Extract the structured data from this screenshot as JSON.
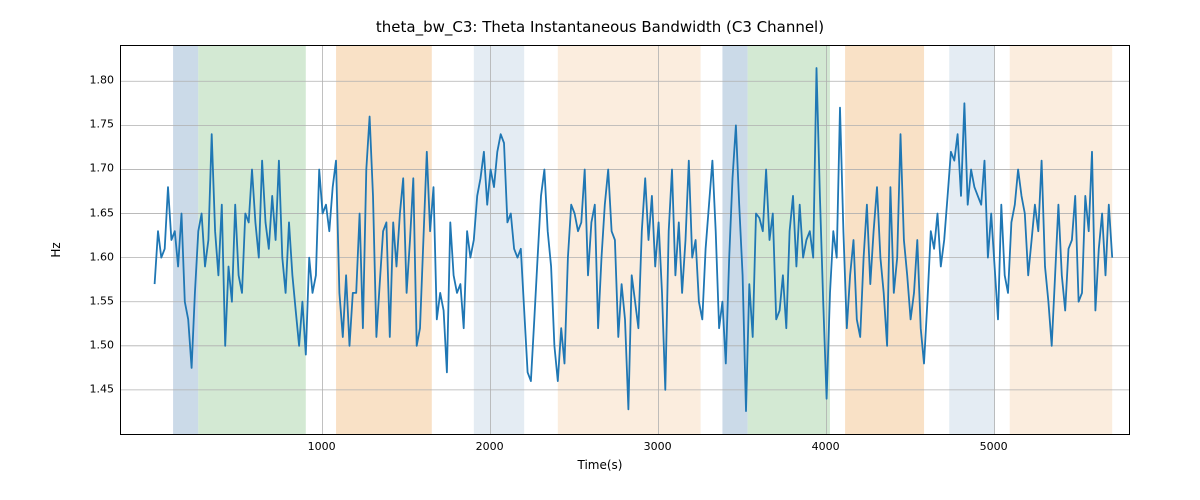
{
  "chart_data": {
    "type": "line",
    "title": "theta_bw_C3: Theta Instantaneous Bandwidth (C3 Channel)",
    "xlabel": "Time(s)",
    "ylabel": "Hz",
    "xlim": [
      -200,
      5800
    ],
    "ylim": [
      1.4,
      1.84
    ],
    "xticks": [
      1000,
      2000,
      3000,
      4000,
      5000
    ],
    "yticks": [
      1.45,
      1.5,
      1.55,
      1.6,
      1.65,
      1.7,
      1.75,
      1.8
    ],
    "grid": true,
    "line_color": "#1f77b4",
    "regions": [
      {
        "x0": 110,
        "x1": 260,
        "color": "#b9cee0"
      },
      {
        "x0": 260,
        "x1": 900,
        "color": "#c4e1c4"
      },
      {
        "x0": 1080,
        "x1": 1650,
        "color": "#f7d7b3"
      },
      {
        "x0": 1900,
        "x1": 2200,
        "color": "#dbe5ef"
      },
      {
        "x0": 2400,
        "x1": 3250,
        "color": "#f9e7d3"
      },
      {
        "x0": 3380,
        "x1": 3530,
        "color": "#b9cee0"
      },
      {
        "x0": 3530,
        "x1": 4020,
        "color": "#c4e1c4"
      },
      {
        "x0": 4110,
        "x1": 4580,
        "color": "#f7d7b3"
      },
      {
        "x0": 4730,
        "x1": 5000,
        "color": "#dbe5ef"
      },
      {
        "x0": 5090,
        "x1": 5700,
        "color": "#f9e7d3"
      }
    ],
    "series": [
      {
        "name": "theta_bw_C3",
        "x": [
          0,
          20,
          40,
          60,
          80,
          100,
          120,
          140,
          160,
          180,
          200,
          220,
          240,
          260,
          280,
          300,
          320,
          340,
          360,
          380,
          400,
          420,
          440,
          460,
          480,
          500,
          520,
          540,
          560,
          580,
          600,
          620,
          640,
          660,
          680,
          700,
          720,
          740,
          760,
          780,
          800,
          820,
          840,
          860,
          880,
          900,
          920,
          940,
          960,
          980,
          1000,
          1020,
          1040,
          1060,
          1080,
          1100,
          1120,
          1140,
          1160,
          1180,
          1200,
          1220,
          1240,
          1260,
          1280,
          1300,
          1320,
          1340,
          1360,
          1380,
          1400,
          1420,
          1440,
          1460,
          1480,
          1500,
          1520,
          1540,
          1560,
          1580,
          1600,
          1620,
          1640,
          1660,
          1680,
          1700,
          1720,
          1740,
          1760,
          1780,
          1800,
          1820,
          1840,
          1860,
          1880,
          1900,
          1920,
          1940,
          1960,
          1980,
          2000,
          2020,
          2040,
          2060,
          2080,
          2100,
          2120,
          2140,
          2160,
          2180,
          2200,
          2220,
          2240,
          2260,
          2280,
          2300,
          2320,
          2340,
          2360,
          2380,
          2400,
          2420,
          2440,
          2460,
          2480,
          2500,
          2520,
          2540,
          2560,
          2580,
          2600,
          2620,
          2640,
          2660,
          2680,
          2700,
          2720,
          2740,
          2760,
          2780,
          2800,
          2820,
          2840,
          2860,
          2880,
          2900,
          2920,
          2940,
          2960,
          2980,
          3000,
          3020,
          3040,
          3060,
          3080,
          3100,
          3120,
          3140,
          3160,
          3180,
          3200,
          3220,
          3240,
          3260,
          3280,
          3300,
          3320,
          3340,
          3360,
          3380,
          3400,
          3420,
          3440,
          3460,
          3480,
          3500,
          3520,
          3540,
          3560,
          3580,
          3600,
          3620,
          3640,
          3660,
          3680,
          3700,
          3720,
          3740,
          3760,
          3780,
          3800,
          3820,
          3840,
          3860,
          3880,
          3900,
          3920,
          3940,
          3960,
          3980,
          4000,
          4020,
          4040,
          4060,
          4080,
          4100,
          4120,
          4140,
          4160,
          4180,
          4200,
          4220,
          4240,
          4260,
          4280,
          4300,
          4320,
          4340,
          4360,
          4380,
          4400,
          4420,
          4440,
          4460,
          4480,
          4500,
          4520,
          4540,
          4560,
          4580,
          4600,
          4620,
          4640,
          4660,
          4680,
          4700,
          4720,
          4740,
          4760,
          4780,
          4800,
          4820,
          4840,
          4860,
          4880,
          4900,
          4920,
          4940,
          4960,
          4980,
          5000,
          5020,
          5040,
          5060,
          5080,
          5100,
          5120,
          5140,
          5160,
          5180,
          5200,
          5220,
          5240,
          5260,
          5280,
          5300,
          5320,
          5340,
          5360,
          5380,
          5400,
          5420,
          5440,
          5460,
          5480,
          5500,
          5520,
          5540,
          5560,
          5580,
          5600,
          5620,
          5640,
          5660,
          5680,
          5700
        ],
        "y": [
          1.57,
          1.63,
          1.6,
          1.61,
          1.68,
          1.62,
          1.63,
          1.59,
          1.65,
          1.55,
          1.53,
          1.475,
          1.56,
          1.63,
          1.65,
          1.59,
          1.62,
          1.74,
          1.63,
          1.58,
          1.66,
          1.5,
          1.59,
          1.55,
          1.66,
          1.58,
          1.56,
          1.65,
          1.64,
          1.7,
          1.64,
          1.6,
          1.71,
          1.64,
          1.61,
          1.67,
          1.62,
          1.71,
          1.6,
          1.56,
          1.64,
          1.58,
          1.54,
          1.5,
          1.55,
          1.49,
          1.6,
          1.56,
          1.58,
          1.7,
          1.65,
          1.66,
          1.63,
          1.68,
          1.71,
          1.56,
          1.51,
          1.58,
          1.5,
          1.56,
          1.56,
          1.65,
          1.52,
          1.7,
          1.76,
          1.67,
          1.51,
          1.57,
          1.63,
          1.64,
          1.51,
          1.64,
          1.59,
          1.65,
          1.69,
          1.56,
          1.62,
          1.69,
          1.5,
          1.52,
          1.62,
          1.72,
          1.63,
          1.68,
          1.53,
          1.56,
          1.54,
          1.47,
          1.64,
          1.58,
          1.56,
          1.57,
          1.52,
          1.63,
          1.6,
          1.62,
          1.67,
          1.69,
          1.72,
          1.66,
          1.7,
          1.68,
          1.72,
          1.74,
          1.73,
          1.64,
          1.65,
          1.61,
          1.6,
          1.61,
          1.54,
          1.47,
          1.46,
          1.53,
          1.6,
          1.67,
          1.7,
          1.63,
          1.59,
          1.5,
          1.46,
          1.52,
          1.48,
          1.6,
          1.66,
          1.65,
          1.63,
          1.64,
          1.7,
          1.58,
          1.64,
          1.66,
          1.52,
          1.6,
          1.66,
          1.7,
          1.63,
          1.62,
          1.51,
          1.57,
          1.53,
          1.428,
          1.58,
          1.55,
          1.52,
          1.63,
          1.69,
          1.62,
          1.67,
          1.59,
          1.64,
          1.56,
          1.45,
          1.63,
          1.7,
          1.58,
          1.64,
          1.56,
          1.62,
          1.71,
          1.6,
          1.62,
          1.55,
          1.53,
          1.61,
          1.66,
          1.71,
          1.63,
          1.52,
          1.55,
          1.48,
          1.6,
          1.69,
          1.75,
          1.66,
          1.58,
          1.426,
          1.57,
          1.51,
          1.65,
          1.645,
          1.63,
          1.7,
          1.62,
          1.65,
          1.53,
          1.54,
          1.58,
          1.52,
          1.63,
          1.67,
          1.59,
          1.66,
          1.6,
          1.62,
          1.63,
          1.6,
          1.815,
          1.67,
          1.55,
          1.44,
          1.56,
          1.63,
          1.6,
          1.77,
          1.63,
          1.52,
          1.58,
          1.62,
          1.53,
          1.51,
          1.6,
          1.66,
          1.57,
          1.63,
          1.68,
          1.6,
          1.56,
          1.5,
          1.68,
          1.56,
          1.6,
          1.74,
          1.62,
          1.58,
          1.53,
          1.56,
          1.62,
          1.52,
          1.48,
          1.55,
          1.63,
          1.61,
          1.65,
          1.59,
          1.62,
          1.67,
          1.72,
          1.71,
          1.74,
          1.67,
          1.775,
          1.66,
          1.7,
          1.68,
          1.67,
          1.66,
          1.71,
          1.6,
          1.65,
          1.59,
          1.53,
          1.66,
          1.58,
          1.56,
          1.64,
          1.66,
          1.7,
          1.67,
          1.65,
          1.58,
          1.62,
          1.66,
          1.63,
          1.71,
          1.59,
          1.55,
          1.5,
          1.58,
          1.66,
          1.58,
          1.54,
          1.61,
          1.62,
          1.67,
          1.55,
          1.56,
          1.67,
          1.63,
          1.72,
          1.54,
          1.61,
          1.65,
          1.58,
          1.66,
          1.6
        ]
      }
    ]
  }
}
